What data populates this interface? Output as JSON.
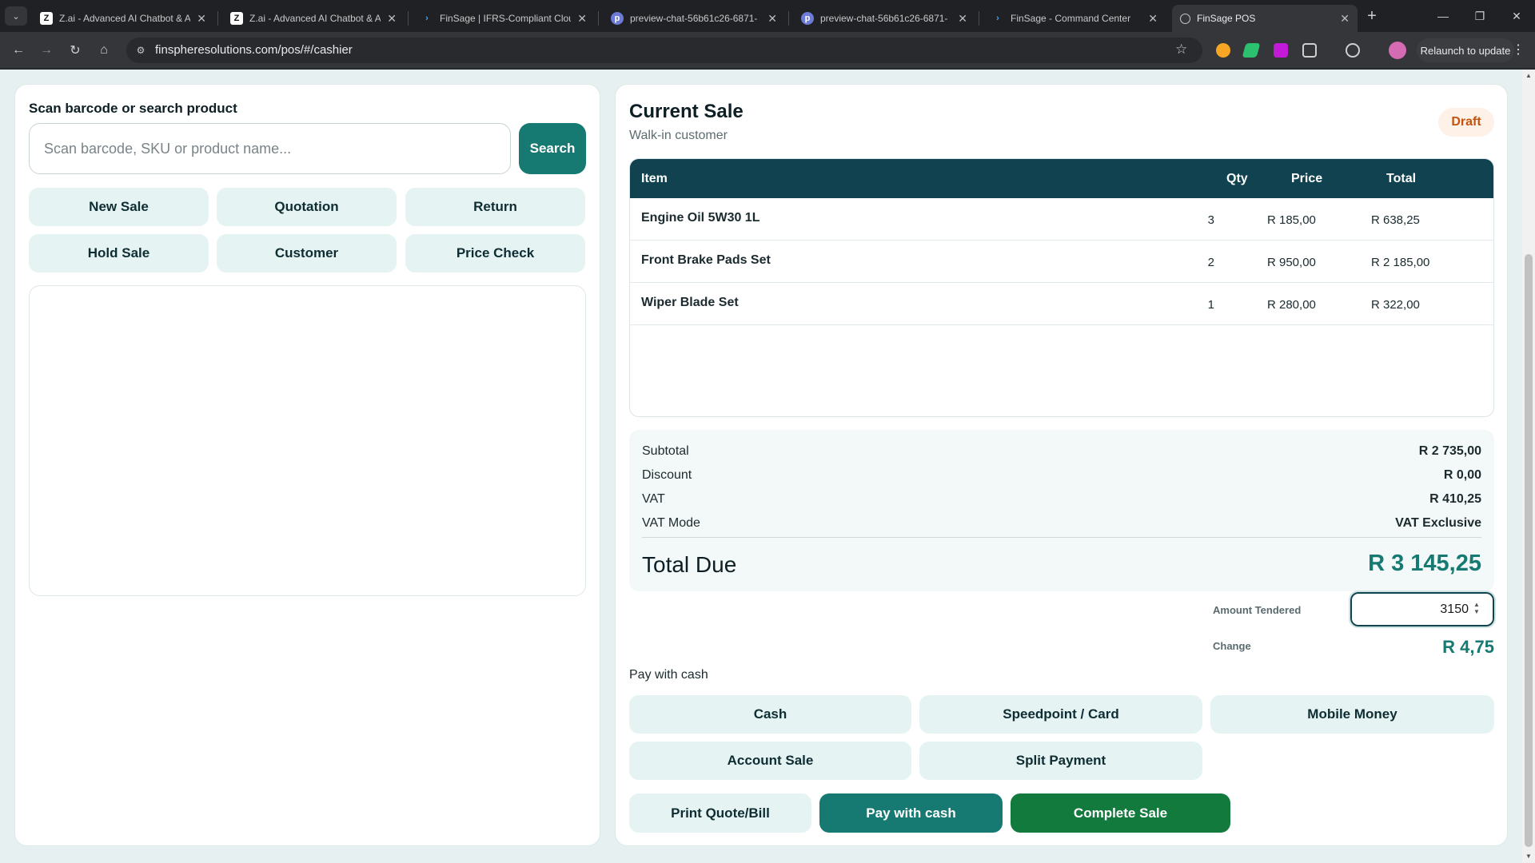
{
  "browser": {
    "tabs": [
      {
        "title": "Z.ai - Advanced AI Chatbot & A",
        "icon": "z-logo-icon",
        "active": false
      },
      {
        "title": "Z.ai - Advanced AI Chatbot & A",
        "icon": "z-logo-icon",
        "active": false
      },
      {
        "title": "FinSage | IFRS-Compliant Clou",
        "icon": "finsage-icon",
        "active": false
      },
      {
        "title": "preview-chat-56b61c26-6871-",
        "icon": "preview-icon",
        "active": false
      },
      {
        "title": "preview-chat-56b61c26-6871-",
        "icon": "preview-icon",
        "active": false
      },
      {
        "title": "FinSage - Command Center",
        "icon": "finsage-icon",
        "active": false
      },
      {
        "title": "FinSage POS",
        "icon": "globe-icon",
        "active": true
      }
    ],
    "url": "finspheresolutions.com/pos/#/cashier",
    "relaunch_label": "Relaunch to update"
  },
  "search": {
    "label": "Scan barcode or search product",
    "placeholder": "Scan barcode, SKU or product name...",
    "button_label": "Search"
  },
  "quick_actions": [
    "New Sale",
    "Quotation",
    "Return",
    "Hold Sale",
    "Customer",
    "Price Check"
  ],
  "sale": {
    "title": "Current Sale",
    "customer": "Walk-in customer",
    "status": "Draft",
    "columns": {
      "item": "Item",
      "qty": "Qty",
      "price": "Price",
      "total": "Total"
    },
    "items": [
      {
        "name": "Engine Oil 5W30 1L",
        "qty": "3",
        "price": "R 185,00",
        "total": "R 638,25"
      },
      {
        "name": "Front Brake Pads Set",
        "qty": "2",
        "price": "R 950,00",
        "total": "R 2 185,00"
      },
      {
        "name": "Wiper Blade Set",
        "qty": "1",
        "price": "R 280,00",
        "total": "R 322,00"
      }
    ]
  },
  "summary": {
    "subtotal_label": "Subtotal",
    "subtotal": "R 2 735,00",
    "discount_label": "Discount",
    "discount": "R 0,00",
    "vat_label": "VAT",
    "vat": "R 410,25",
    "vat_mode_label": "VAT Mode",
    "vat_mode": "VAT Exclusive",
    "total_due_label": "Total Due",
    "total_due": "R 3 145,25"
  },
  "tender": {
    "amount_label": "Amount Tendered",
    "amount_value": "3150",
    "change_label": "Change",
    "change_value": "R 4,75"
  },
  "payment": {
    "pay_with_label": "Pay with cash",
    "methods": [
      "Cash",
      "Speedpoint / Card",
      "Mobile Money",
      "Account Sale",
      "Split Payment"
    ]
  },
  "actions": {
    "print_label": "Print Quote/Bill",
    "pay_label": "Pay with cash",
    "complete_label": "Complete Sale"
  },
  "colors": {
    "accent": "#177a72",
    "header": "#10424f",
    "complete": "#137a3d",
    "draft": "#c4530f",
    "button_bg": "#e6f3f3"
  }
}
